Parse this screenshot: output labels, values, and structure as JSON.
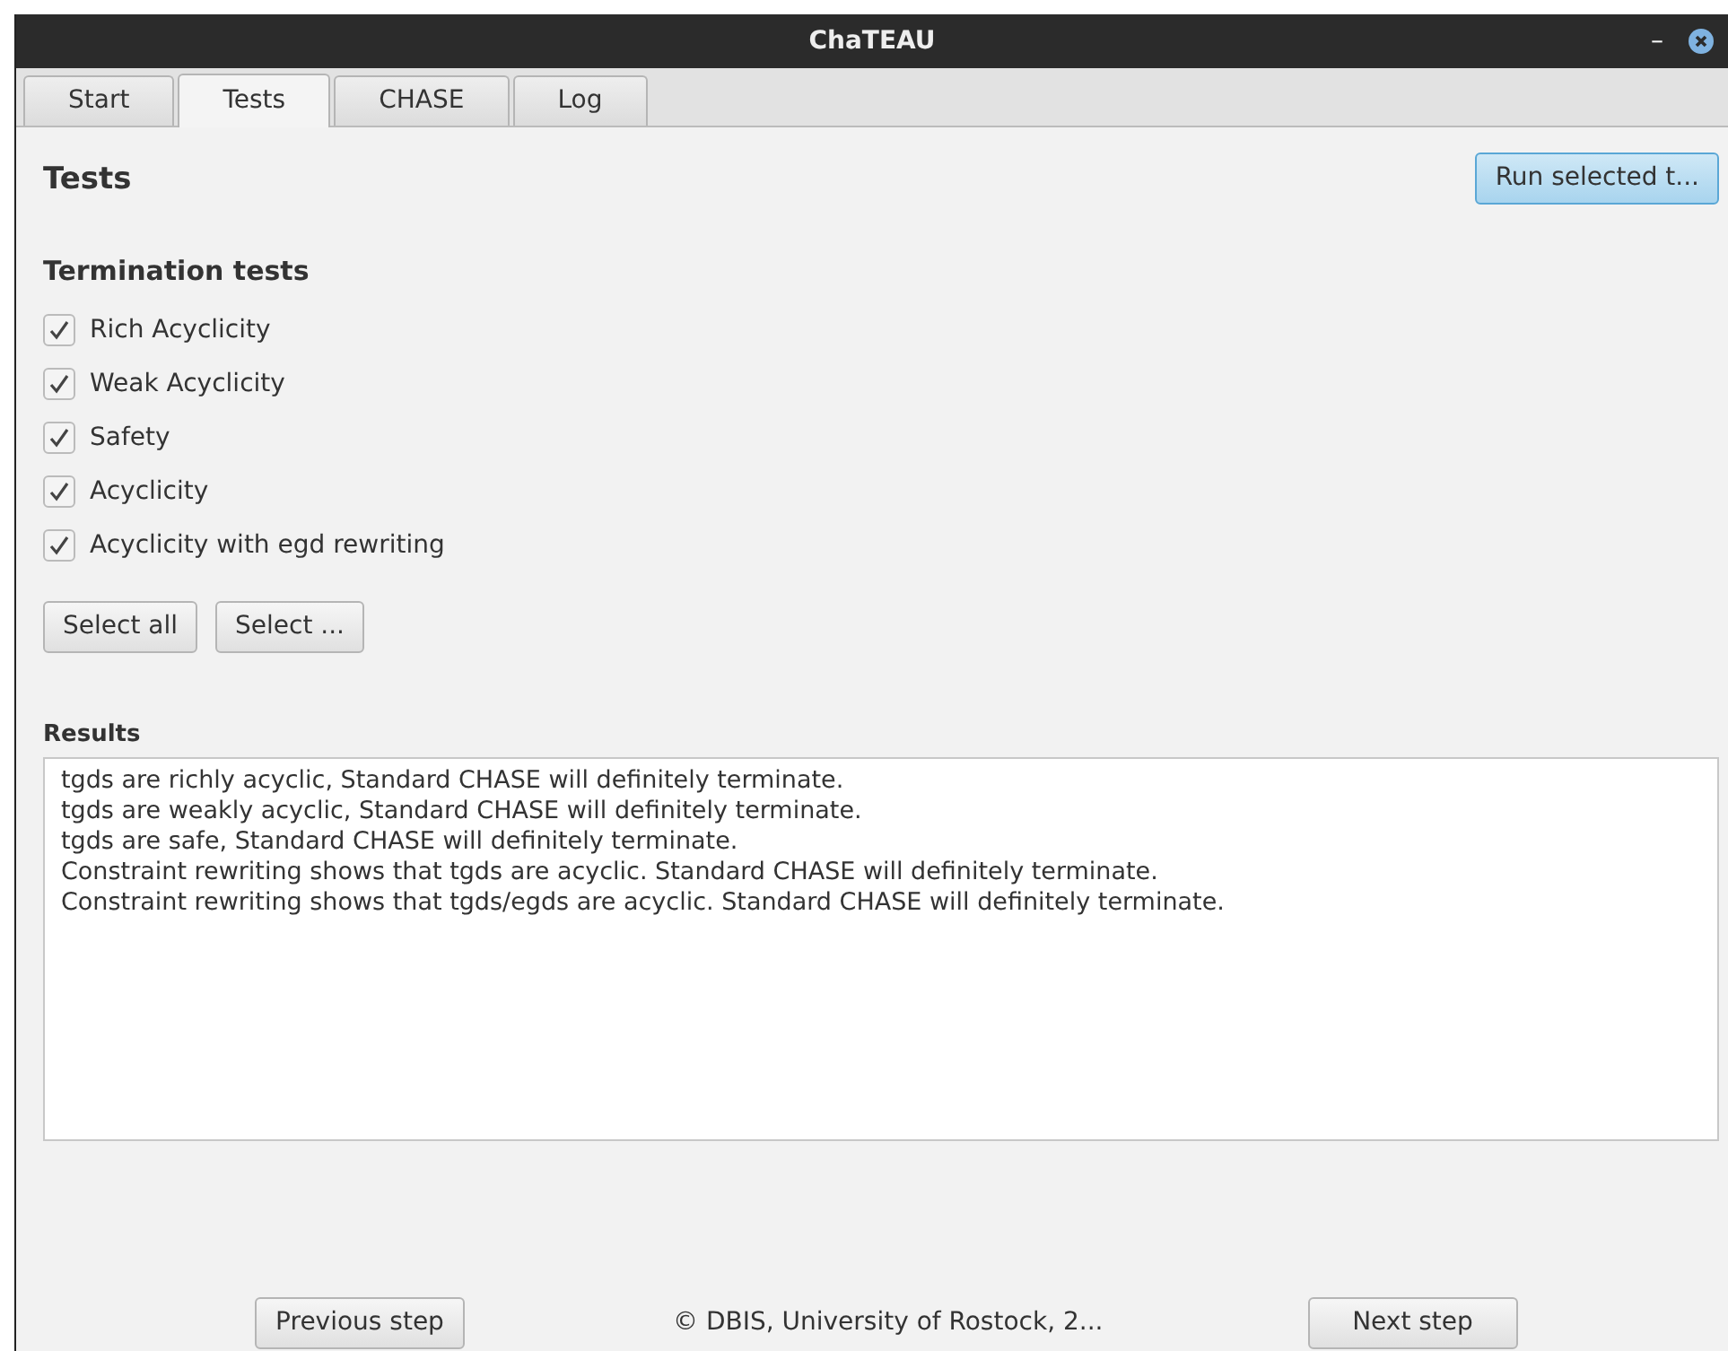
{
  "window": {
    "title": "ChaTEAU",
    "controls": [
      "–"
    ]
  },
  "tabs": [
    {
      "label": "Start",
      "selected": false
    },
    {
      "label": "Tests",
      "selected": true
    },
    {
      "label": "CHASE",
      "selected": false
    },
    {
      "label": "Log",
      "selected": false
    }
  ],
  "heading": "Tests",
  "run_button": "Run selected t...",
  "section": "Termination tests",
  "tests": [
    {
      "label": "Rich Acyclicity",
      "checked": true
    },
    {
      "label": "Weak Acyclicity",
      "checked": true
    },
    {
      "label": "Safety",
      "checked": true
    },
    {
      "label": "Acyclicity",
      "checked": true
    },
    {
      "label": "Acyclicity with egd rewriting",
      "checked": true
    }
  ],
  "select_buttons": [
    "Select all",
    "Select ..."
  ],
  "results": {
    "label": "Results",
    "lines": [
      "tgds are richly acyclic, Standard CHASE will definitely terminate.",
      "tgds are weakly acyclic, Standard CHASE will definitely terminate.",
      "tgds are safe, Standard CHASE will definitely terminate.",
      "Constraint rewriting shows that tgds are acyclic. Standard CHASE will definitely terminate.",
      "Constraint rewriting shows that tgds/egds are acyclic. Standard CHASE will definitely terminate."
    ]
  },
  "footer": {
    "previous": "Previous step",
    "copyright": "© DBIS, University of Rostock, 2...",
    "next": "Next step"
  }
}
